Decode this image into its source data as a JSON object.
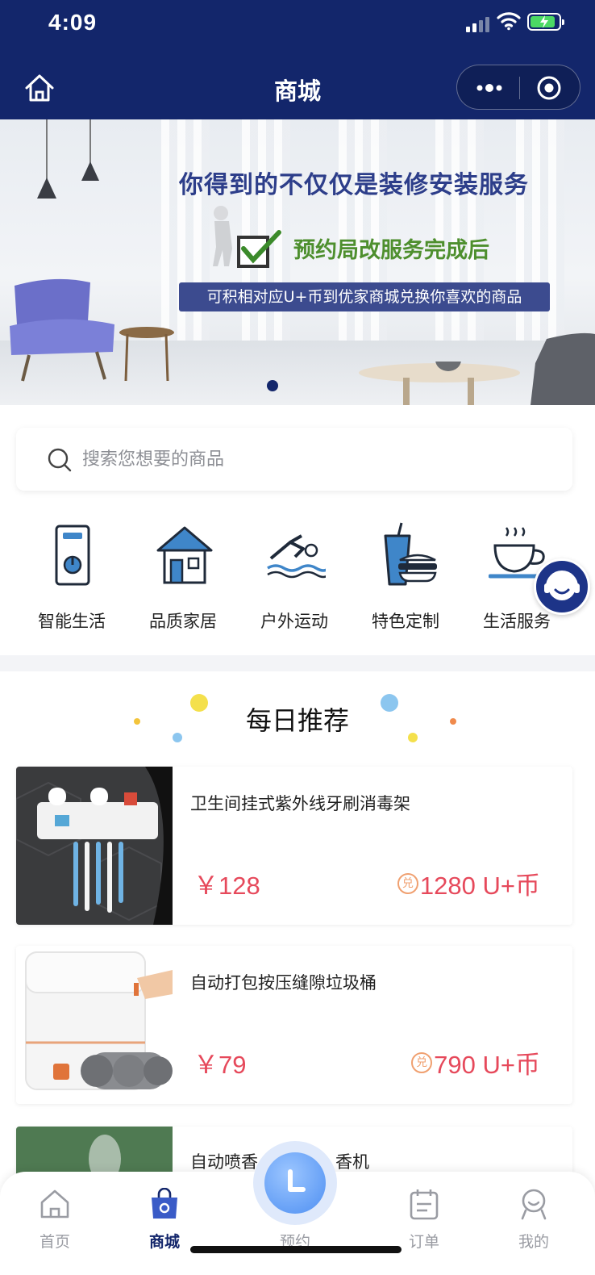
{
  "status_bar": {
    "time": "4:09"
  },
  "nav": {
    "title": "商城"
  },
  "banner": {
    "headline": "你得到的不仅仅是装修安装服务",
    "subline": "预约局改服务完成后",
    "tagline": "可积相对应U+币到优家商城兑换你喜欢的商品"
  },
  "search": {
    "placeholder": "搜索您想要的商品"
  },
  "categories": [
    {
      "label": "智能生活",
      "icon": "smart-switch-icon"
    },
    {
      "label": "品质家居",
      "icon": "house-icon"
    },
    {
      "label": "户外运动",
      "icon": "swimmer-icon"
    },
    {
      "label": "特色定制",
      "icon": "drink-burger-icon"
    },
    {
      "label": "生活服务",
      "icon": "coffee-cup-icon"
    }
  ],
  "daily": {
    "title": "每日推荐",
    "items": [
      {
        "name": "卫生间挂式紫外线牙刷消毒架",
        "price": "￥128",
        "coin_badge": "兑",
        "coins": "1280 U+币"
      },
      {
        "name": "自动打包按压缝隙垃圾桶",
        "price": "￥79",
        "coin_badge": "兑",
        "coins": "790 U+币"
      },
      {
        "name": "自动喷香",
        "name_tail": "香机"
      }
    ]
  },
  "tabbar": {
    "tabs": [
      {
        "label": "首页",
        "icon": "home-icon"
      },
      {
        "label": "商城",
        "icon": "shopping-bag-icon",
        "active": true
      },
      {
        "label": "预约",
        "icon": "clock-icon"
      },
      {
        "label": "订单",
        "icon": "order-icon"
      },
      {
        "label": "我的",
        "icon": "user-icon"
      }
    ]
  },
  "colors": {
    "nav_bg": "#13266b",
    "price": "#e6495b",
    "coin_badge": "#f0a070",
    "banner_green": "#4e8f2e"
  }
}
